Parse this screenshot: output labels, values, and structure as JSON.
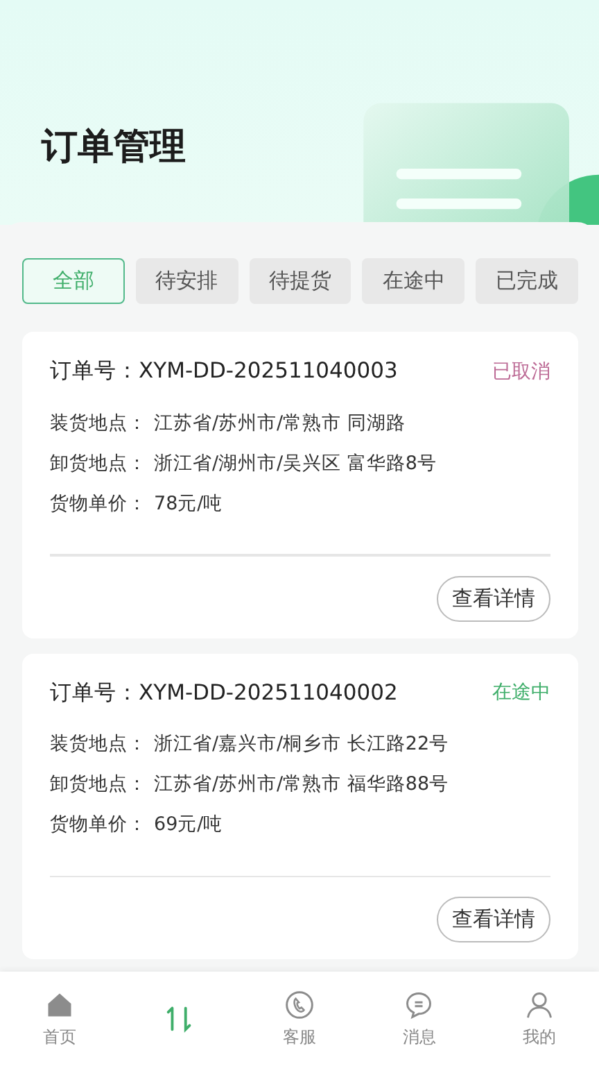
{
  "header": {
    "title": "订单管理"
  },
  "tabs": [
    {
      "label": "全部",
      "selected": true
    },
    {
      "label": "待安排",
      "selected": false
    },
    {
      "label": "待提货",
      "selected": false
    },
    {
      "label": "在途中",
      "selected": false
    },
    {
      "label": "已完成",
      "selected": false
    }
  ],
  "orders": [
    {
      "order_label": "订单号：",
      "order_no": "XYM-DD-202511040003",
      "status": "已取消",
      "kind": "cancelled",
      "fields": [
        {
          "label": "装货地点：",
          "value": "江苏省/苏州市/常熟市 同湖路"
        },
        {
          "label": "卸货地点：",
          "value": "浙江省/湖州市/吴兴区 富华路8号"
        },
        {
          "label": "货物单价：",
          "value": "78元/吨"
        }
      ],
      "button": "查看详情"
    },
    {
      "order_label": "订单号：",
      "order_no": "XYM-DD-202511040002",
      "status": "在途中",
      "kind": "in_transit",
      "fields": [
        {
          "label": "装货地点：",
          "value": "浙江省/嘉兴市/桐乡市 长江路22号"
        },
        {
          "label": "卸货地点：",
          "value": "江苏省/苏州市/常熟市 福华路88号"
        },
        {
          "label": "货物单价：",
          "value": "69元/吨"
        }
      ],
      "button": "查看详情"
    }
  ],
  "nav": [
    {
      "kind": "home",
      "label": "首页",
      "selected": false
    },
    {
      "kind": "orders",
      "selected": true
    },
    {
      "kind": "service",
      "label": "客服",
      "selected": false
    },
    {
      "kind": "message",
      "label": "消息",
      "selected": false
    },
    {
      "kind": "profile",
      "label": "我的",
      "selected": false
    }
  ]
}
